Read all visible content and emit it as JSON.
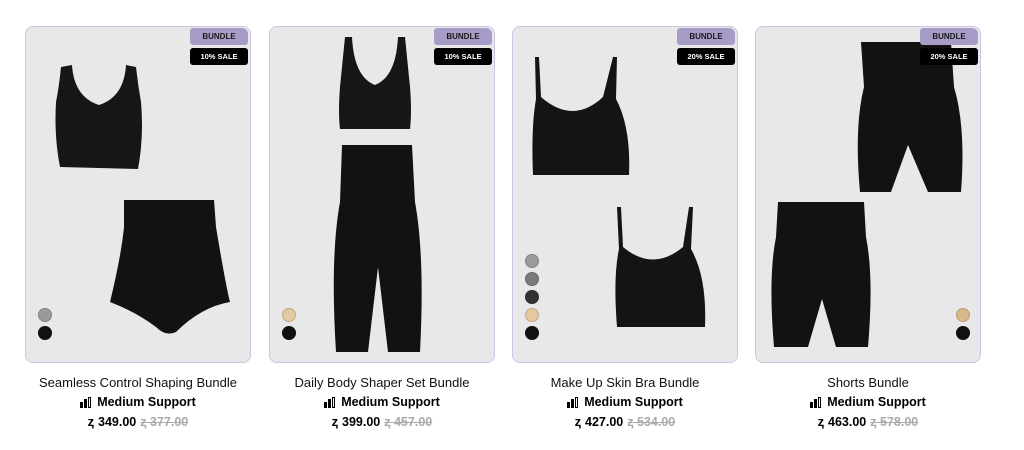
{
  "products": [
    {
      "name": "Seamless Control Shaping Bundle",
      "badge": "BUNDLE",
      "sale": "10% SALE",
      "support": "Medium Support",
      "price": "ر.س 349.00",
      "price_value": "349.00",
      "old_price_value": "377.00",
      "currency_symbol": "ⱬ",
      "swatches": [
        "#9a9a9a",
        "#111111"
      ]
    },
    {
      "name": "Daily Body Shaper Set Bundle",
      "badge": "BUNDLE",
      "sale": "10% SALE",
      "support": "Medium Support",
      "price_value": "399.00",
      "old_price_value": "457.00",
      "currency_symbol": "ⱬ",
      "swatches": [
        "#e3c8a0",
        "#111111"
      ]
    },
    {
      "name": "Make Up Skin Bra Bundle",
      "badge": "BUNDLE",
      "sale": "20% SALE",
      "support": "Medium Support",
      "price_value": "427.00",
      "old_price_value": "534.00",
      "currency_symbol": "ⱬ",
      "swatches": [
        "#9a9a9a",
        "#7a7a7a",
        "#333333",
        "#e3c8a0",
        "#111111"
      ]
    },
    {
      "name": "Shorts Bundle",
      "badge": "BUNDLE",
      "sale": "20% SALE",
      "support": "Medium Support",
      "price_value": "463.00",
      "old_price_value": "578.00",
      "currency_symbol": "ⱬ",
      "swatches": [
        "#d9b98a",
        "#111111"
      ]
    }
  ],
  "colors": {
    "card_border": "#cdc4e4",
    "card_bg": "#e8e8e8",
    "bundle_badge": "#a79bc7",
    "sale_badge": "#000000"
  }
}
